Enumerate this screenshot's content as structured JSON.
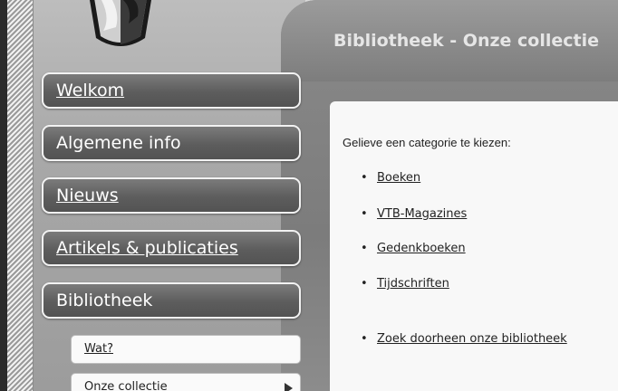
{
  "header": {
    "title": "Bibliotheek - Onze collectie"
  },
  "nav": {
    "items": [
      {
        "label": "Welkom"
      },
      {
        "label": "Algemene info"
      },
      {
        "label": "Nieuws"
      },
      {
        "label": "Artikels & publicaties"
      },
      {
        "label": "Bibliotheek"
      }
    ],
    "sub_items": [
      {
        "label": "Wat?"
      },
      {
        "label": "Onze collectie"
      }
    ]
  },
  "content": {
    "intro": "Gelieve een categorie te kiezen:",
    "categories": [
      "Boeken",
      "VTB-Magazines",
      "Gedenkboeken",
      "Tijdschriften"
    ],
    "search_link": "Zoek doorheen onze bibliotheek",
    "bullet": "•"
  }
}
